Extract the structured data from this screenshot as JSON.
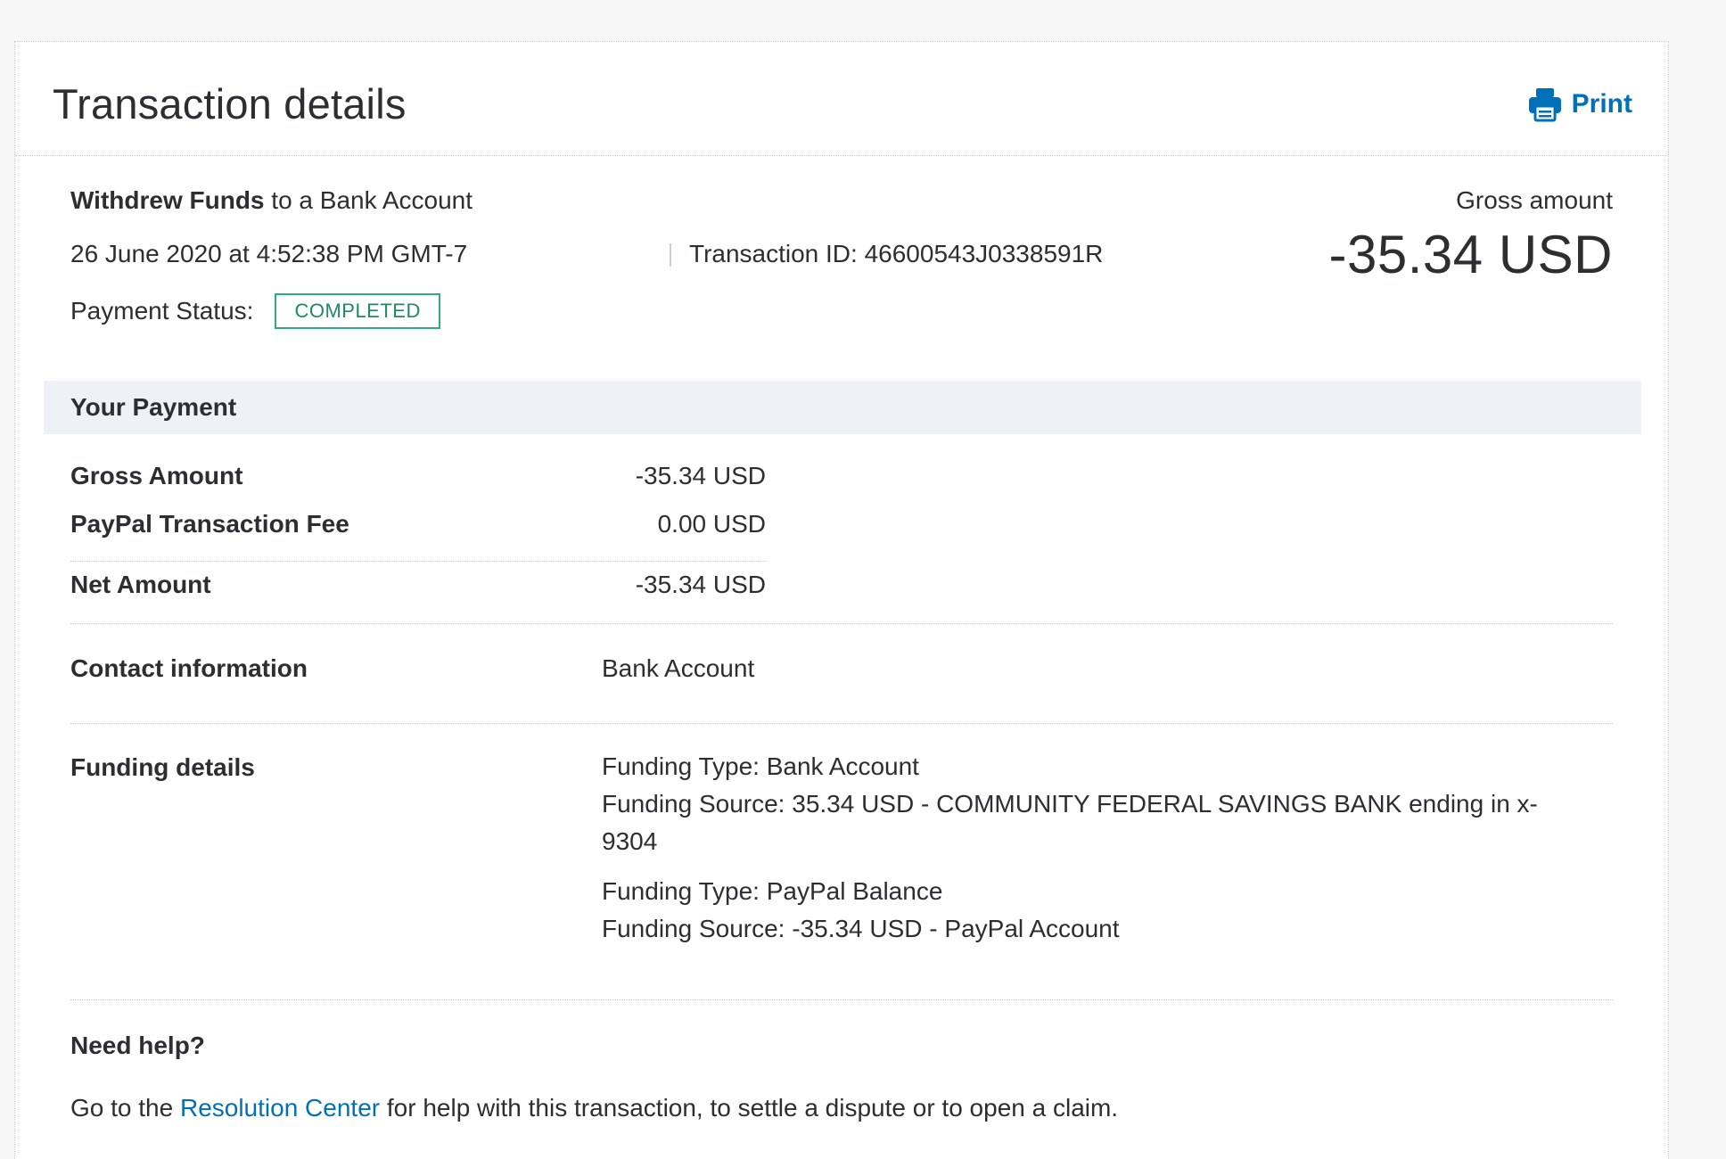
{
  "header": {
    "title": "Transaction details",
    "print_label": "Print"
  },
  "summary": {
    "type_bold": "Withdrew Funds",
    "type_rest": " to a Bank Account",
    "date": "26 June 2020 at 4:52:38 PM GMT-7",
    "transaction_id": "Transaction ID: 46600543J0338591R",
    "status_label": "Payment Status:",
    "status_value": "COMPLETED",
    "gross_label": "Gross amount",
    "gross_value": "-35.34 USD"
  },
  "payment": {
    "section_title": "Your Payment",
    "rows": [
      {
        "label": "Gross Amount",
        "value": "-35.34 USD"
      },
      {
        "label": "PayPal Transaction Fee",
        "value": "0.00 USD"
      },
      {
        "label": "Net Amount",
        "value": "-35.34 USD"
      }
    ]
  },
  "contact": {
    "label": "Contact information",
    "value": "Bank Account"
  },
  "funding": {
    "label": "Funding details",
    "type_1": "Funding Type: Bank Account",
    "source_1": "Funding Source: 35.34 USD - COMMUNITY FEDERAL SAVINGS BANK ending in x-9304",
    "type_2": "Funding Type: PayPal Balance",
    "source_2": "Funding Source: -35.34 USD - PayPal Account"
  },
  "help": {
    "title": "Need help?",
    "text_before": "Go to the ",
    "link": "Resolution Center",
    "text_after": " for help with this transaction, to settle a dispute or to open a claim."
  },
  "colors": {
    "link": "#0070ba",
    "status_border": "#2eab82",
    "band": "#eef1f6"
  },
  "icons": {
    "print": "printer-icon"
  }
}
